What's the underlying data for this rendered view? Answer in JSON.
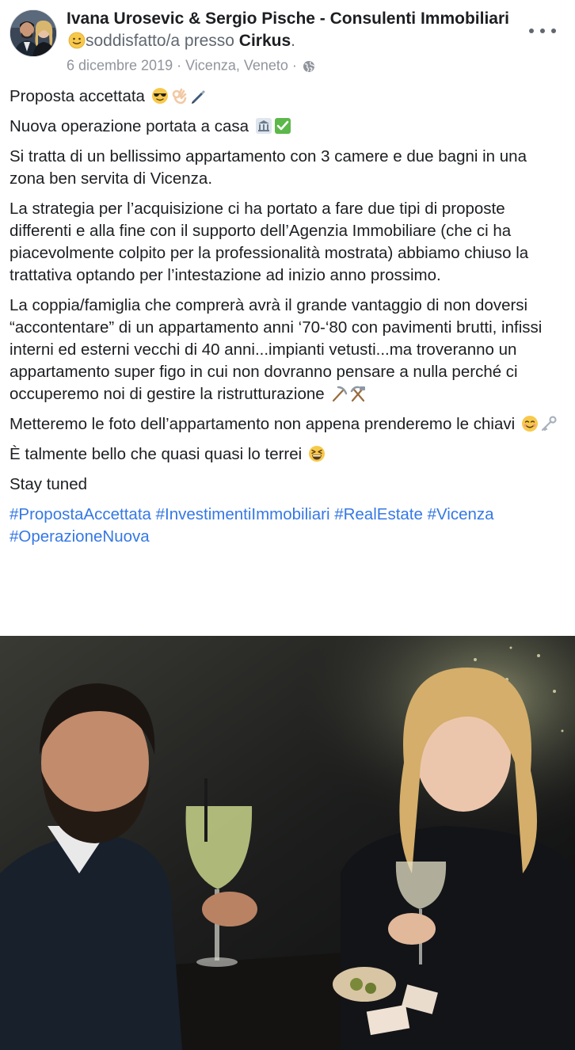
{
  "post": {
    "author": "Ivana Urosevic & Sergio Pische - Consulenti Immobiliari",
    "feeling_emoji": "slightly-smiling-face",
    "feeling_text": "soddisfatto/a presso",
    "place": "Cirkus",
    "place_suffix": ".",
    "date": "6 dicembre 2019",
    "separator": "·",
    "location": "Vicenza, Veneto",
    "privacy_icon": "globe-icon",
    "more_icon": "more-options-icon"
  },
  "content": {
    "p1": "Proposta accettata",
    "p1_emojis": [
      "sunglasses-face",
      "ok-hand",
      "pen"
    ],
    "p2": "Nuova operazione portata a casa",
    "p2_emojis": [
      "bank-building",
      "check-mark-box"
    ],
    "p3": "Si tratta di un bellissimo appartamento con 3 camere e due bagni in una zona ben servita di Vicenza.",
    "p4": "La strategia per l’acquisizione ci ha portato a fare due tipi di proposte differenti e alla fine con il supporto dell’Agenzia Immobiliare (che ci ha piacevolmente colpito per la professionalità mostrata) abbiamo chiuso la trattativa optando per l’intestazione ad inizio anno prossimo.",
    "p5": "La coppia/famiglia che comprerà avrà il grande vantaggio di non doversi “accontentare” di un appartamento anni ‘70-‘80 con pavimenti brutti, infissi interni ed esterni vecchi di 40 anni...impianti vetusti...ma troveranno un appartamento super figo in cui non dovranno pensare a nulla perché ci occuperemo noi di gestire la ristrutturazione",
    "p5_emojis": [
      "pick",
      "hammer-and-pick"
    ],
    "p6": "Metteremo le foto dell’appartamento non appena prenderemo le chiavi",
    "p6_emojis": [
      "smiling-face",
      "key"
    ],
    "p7": "È talmente bello che quasi quasi lo terrei",
    "p7_emojis": [
      "grinning-squinting-face"
    ],
    "p8": "Stay tuned",
    "hashtags": [
      "#PropostaAccettata",
      "#InvestimentiImmobiliari",
      "#RealEstate",
      "#Vicenza",
      "#OperazioneNuova"
    ]
  },
  "colors": {
    "text": "#1c1e21",
    "muted": "#90949c",
    "link": "#3578e5"
  }
}
